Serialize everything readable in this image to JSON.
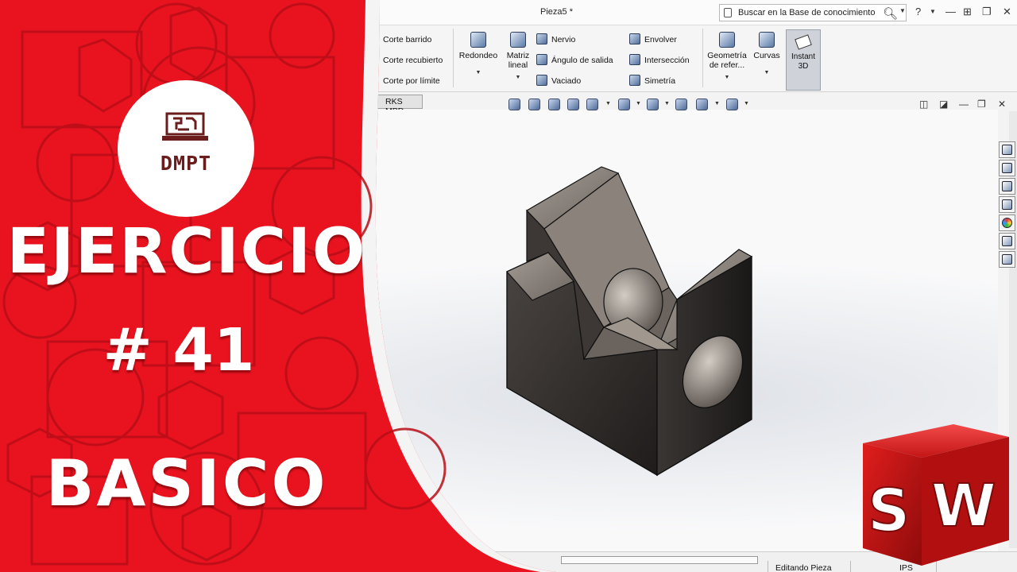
{
  "window": {
    "doc_title": "Pieza5 *",
    "search_label": "Buscar en la Base de conocimiento",
    "help_label": "?"
  },
  "ribbon": {
    "sweep_cut": "Corte barrido",
    "loft_cut": "Corte recubierto",
    "boundary_cut": "Corte por límite",
    "fillet": "Redondeo",
    "linear_pattern_line1": "Matriz",
    "linear_pattern_line2": "lineal",
    "rib": "Nervio",
    "draft": "Ángulo de salida",
    "shell": "Vaciado",
    "wrap": "Envolver",
    "intersect": "Intersección",
    "mirror": "Simetría",
    "ref_geometry_line1": "Geometría",
    "ref_geometry_line2": "de refer...",
    "curves": "Curvas",
    "instant3d_line1": "Instant",
    "instant3d_line2": "3D"
  },
  "tabs": {
    "mbd": "RKS MBD"
  },
  "status": {
    "editing": "Editando Pieza",
    "units": "IPS"
  },
  "overlay": {
    "logo_text": "DMPT",
    "line1": "EJERCICIO",
    "line2": "# 41",
    "line3": "BASICO"
  },
  "sw_logo": {
    "letter1": "S",
    "letter2": "W"
  },
  "colors": {
    "overlay_red": "#e8131f",
    "overlay_dark_red": "#b80e17",
    "part_dark": "#2f2b29",
    "part_top": "#8f8780"
  }
}
